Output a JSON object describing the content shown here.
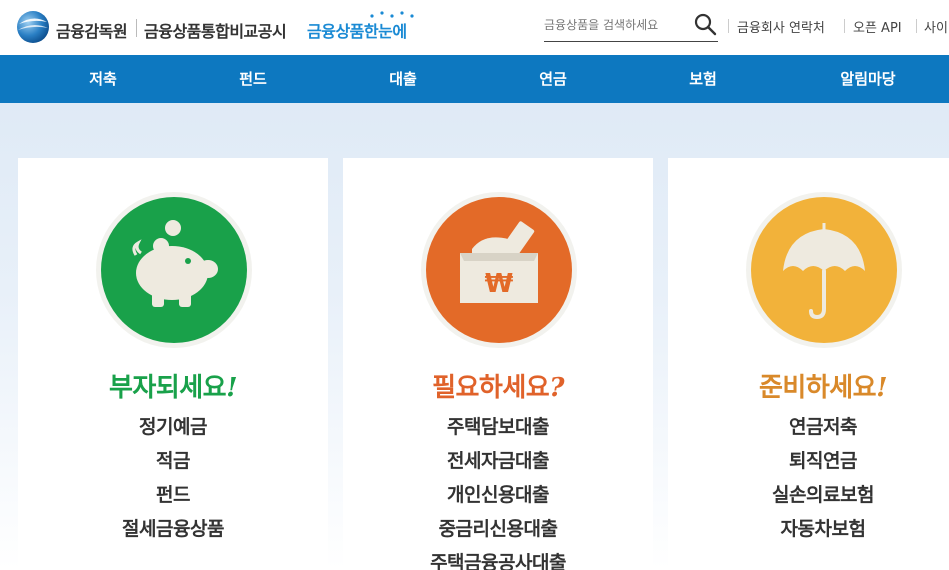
{
  "header": {
    "logo_fss": "금융감독원",
    "logo_site": "금융상품통합비교공시",
    "logo_brand": "금융상품한눈에",
    "search": {
      "placeholder": "금융상품을 검색하세요",
      "icon": "search-icon"
    },
    "utility_links": [
      "금융회사 연락처",
      "오픈 API",
      "사이"
    ]
  },
  "nav": {
    "items": [
      "저축",
      "펀드",
      "대출",
      "연금",
      "보험",
      "알림마당"
    ]
  },
  "cards": [
    {
      "title": "부자되세요",
      "mark": "!",
      "color": "#19a14a",
      "icon_bg": "#19a14a",
      "icon": "piggy-bank-icon",
      "items": [
        "정기예금",
        "적금",
        "펀드",
        "절세금융상품"
      ]
    },
    {
      "title": "필요하세요",
      "mark": "?",
      "color": "#e0622a",
      "icon_bg": "#e36a28",
      "icon": "money-box-icon",
      "items": [
        "주택담보대출",
        "전세자금대출",
        "개인신용대출",
        "중금리신용대출",
        "주택금융공사대출"
      ]
    },
    {
      "title": "준비하세요",
      "mark": "!",
      "color": "#d9892a",
      "icon_bg": "#f2b23a",
      "icon": "umbrella-icon",
      "items": [
        "연금저축",
        "퇴직연금",
        "실손의료보험",
        "자동차보험"
      ]
    }
  ]
}
